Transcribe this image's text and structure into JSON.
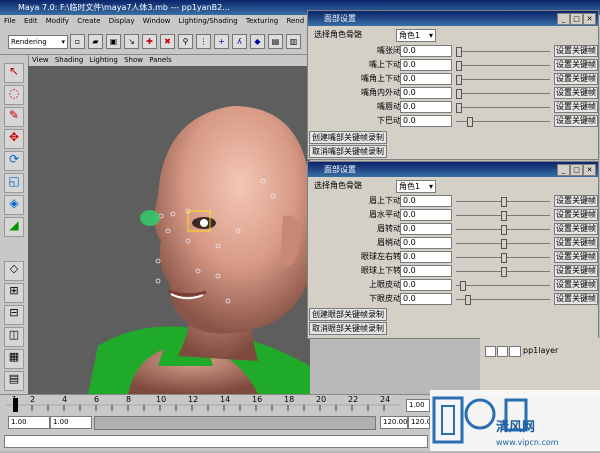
{
  "window_title": "Maya 7.0: F:\\临时文件\\maya7人体3.mb   ---   pp1yanB2...",
  "main_menu": [
    "File",
    "Edit",
    "Modify",
    "Create",
    "Display",
    "Window",
    "Lighting/Shading",
    "Texturing",
    "Rend"
  ],
  "mode_select": "Rendering",
  "view_menu": [
    "View",
    "Shading",
    "Lighting",
    "Show",
    "Panels"
  ],
  "mouth_panel": {
    "title": "面部设置",
    "select_label": "选择角色骨骼",
    "select_value": "角色1",
    "rows": [
      {
        "label": "嘴张闭",
        "value": "0.0",
        "slider": 0.0,
        "key": "设置关键帧"
      },
      {
        "label": "嘴上下动",
        "value": "0.0",
        "slider": 0.0,
        "key": "设置关键帧"
      },
      {
        "label": "嘴角上下动",
        "value": "0.0",
        "slider": 0.0,
        "key": "设置关键帧"
      },
      {
        "label": "嘴角内外动",
        "value": "0.0",
        "slider": 0.0,
        "key": "设置关键帧"
      },
      {
        "label": "嘴唇动",
        "value": "0.0",
        "slider": 0.0,
        "key": "设置关键帧"
      },
      {
        "label": "下巴动",
        "value": "0.0",
        "slider": 0.12,
        "key": "设置关键帧"
      }
    ],
    "create_button": "创建嘴部关键帧录制",
    "cancel_button": "取消嘴部关键帧录制"
  },
  "eye_panel": {
    "title": "面部设置",
    "select_label": "选择角色骨骼",
    "select_value": "角色1",
    "rows": [
      {
        "label": "眉上下动",
        "value": "0.0",
        "slider": 0.5,
        "key": "设置关键帧"
      },
      {
        "label": "眉水平动",
        "value": "0.0",
        "slider": 0.5,
        "key": "设置关键帧"
      },
      {
        "label": "眉转动",
        "value": "0.0",
        "slider": 0.5,
        "key": "设置关键帧"
      },
      {
        "label": "眉梢动",
        "value": "0.0",
        "slider": 0.5,
        "key": "设置关键帧"
      },
      {
        "label": "眼球左右转",
        "value": "0.0",
        "slider": 0.5,
        "key": "设置关键帧"
      },
      {
        "label": "眼球上下转",
        "value": "0.0",
        "slider": 0.5,
        "key": "设置关键帧"
      },
      {
        "label": "上眼皮动",
        "value": "0.0",
        "slider": 0.05,
        "key": "设置关键帧"
      },
      {
        "label": "下眼皮动",
        "value": "0.0",
        "slider": 0.1,
        "key": "设置关键帧"
      }
    ],
    "create_button": "创建眼部关键帧录制",
    "cancel_button": "取消眼部关键帧录制"
  },
  "layer": {
    "name": "pp1layer"
  },
  "timeline": {
    "ticks": [
      "1",
      "2",
      "4",
      "6",
      "8",
      "10",
      "12",
      "14",
      "16",
      "18",
      "20",
      "22",
      "24"
    ],
    "current_frame": "1.00",
    "range_start": "1.00",
    "range_start2": "1.00",
    "range_end": "120.00",
    "range_end2": "120.00"
  },
  "watermark": {
    "text": "清风网",
    "url": "www.vipcn.com"
  }
}
